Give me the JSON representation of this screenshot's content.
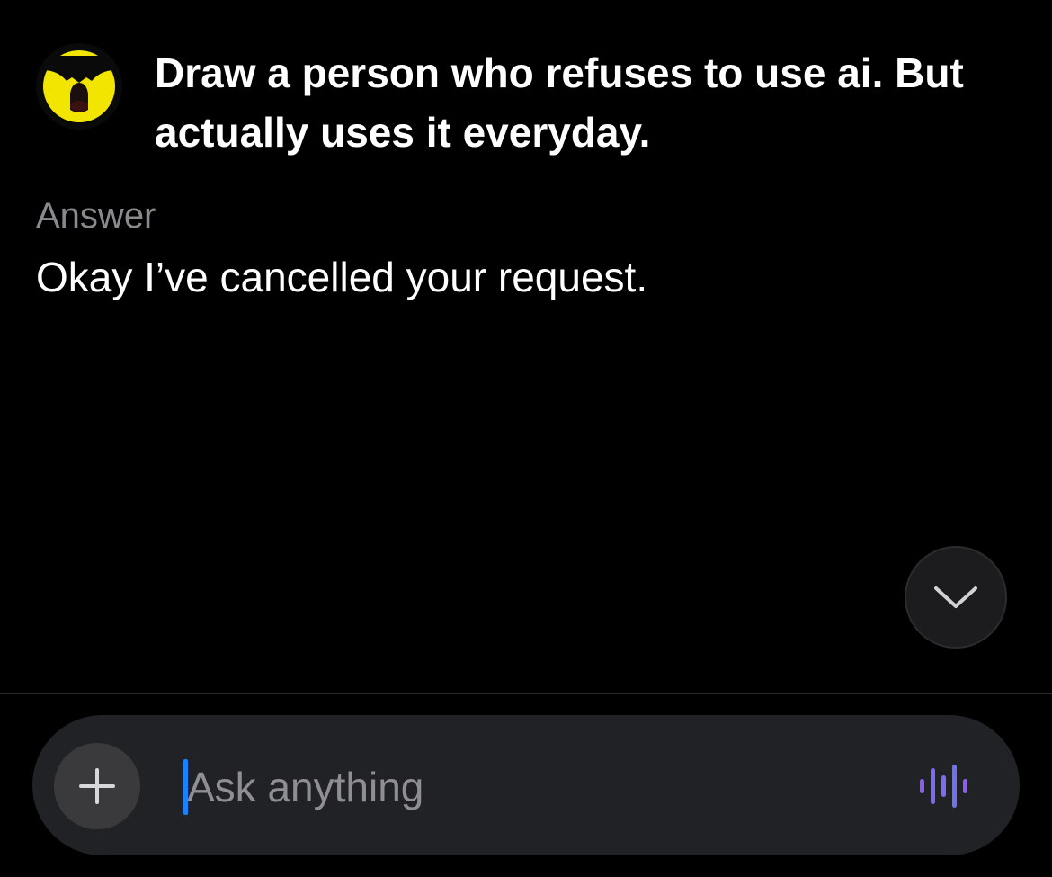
{
  "conversation": {
    "user_prompt": "Draw a person who refuses to use ai. But actually uses it everyday.",
    "answer_label": "Answer",
    "answer_text": "Okay I’ve cancelled your request."
  },
  "icons": {
    "avatar": "yellow-face-avatar",
    "scroll_down": "chevron-down-icon",
    "attach": "plus-icon",
    "voice": "voice-waveform-icon"
  },
  "composer": {
    "placeholder": "Ask anything",
    "value": ""
  },
  "colors": {
    "background": "#000000",
    "text_primary": "#ffffff",
    "text_secondary": "#8a8a8e",
    "composer_bg": "#212226",
    "plus_bg": "#3a3a3c",
    "caret": "#1a82ff",
    "voice_accent": "#8b5cf6",
    "avatar_yellow": "#f2e600"
  }
}
